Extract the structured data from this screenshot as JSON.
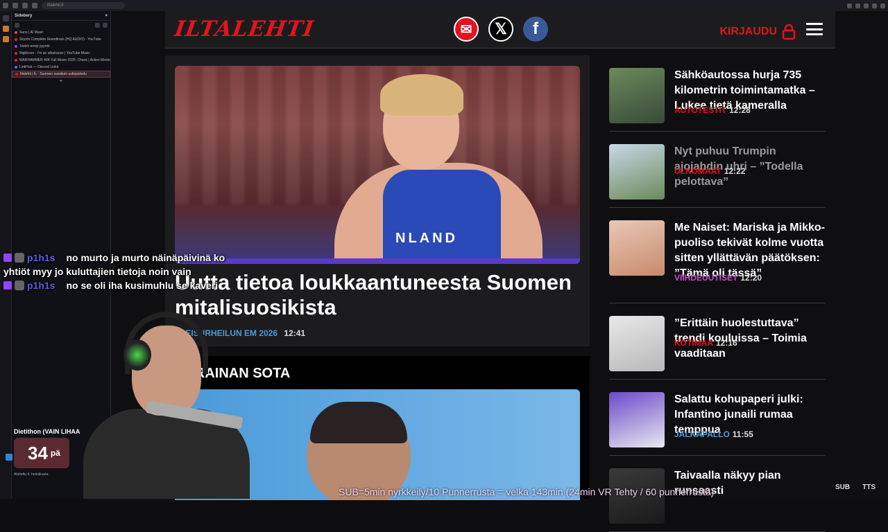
{
  "browser": {
    "url": "iltalehti.fi"
  },
  "sidebery": {
    "title": "Sidebery",
    "close": "×",
    "tabs": [
      {
        "label": "Suno | AI Music",
        "color": "#e84a4a"
      },
      {
        "label": "Skyrim Complete Soundtrack (HQ AUDIO) - YouTube",
        "color": "#e82222"
      },
      {
        "label": "Twitch emoji pyyntö",
        "color": "#9146ff"
      },
      {
        "label": "Nightcore - I'm an albatraozz | YouTube Music",
        "color": "#e82222"
      },
      {
        "label": "WARHAMMER 40K Full Movie 2025: Chaos | Action Movies",
        "color": "#e82222"
      },
      {
        "label": "LinkHub — Discord Linkit",
        "color": "#5a6ae8"
      },
      {
        "label": "Iltalehti | IL - Suomen suosituin uutispalvelu",
        "color": "#e3121f"
      }
    ],
    "add": "+"
  },
  "header": {
    "logo": "ILTALEHTI",
    "login": "KIRJAUDU",
    "x_glyph": "𝕏",
    "fb_glyph": "f",
    "mail_glyph": "✉"
  },
  "main_article": {
    "shirt_text": "NLAND",
    "title": "Uutta tietoa loukkaantuneesta Suomen mitalisuosikista",
    "category": "YLEISURHEILUN EM 2026",
    "time": "12:41"
  },
  "second_article": {
    "label": "UKRAINAN SOTA"
  },
  "side_articles": [
    {
      "title": "Sähköautossa hurja 735 kilometrin toimintamatka – Lukee tietä kameralla",
      "category": "AUTOTESTIT",
      "time": "12:28",
      "cat_color": "#e3121f",
      "dim": false
    },
    {
      "title": "Nyt puhuu Trumpin ajojahdin uhri – ”Todella pelottava”",
      "category": "ULKOMAAT",
      "time": "12:22",
      "cat_color": "#e3121f",
      "dim": true
    },
    {
      "title": "Me Naiset: Mariska ja Mikko-puoliso tekivät kolme vuotta sitten yllättävän päätöksen: ”Tämä oli tässä”",
      "category": "VIIHDEUUTISET",
      "time": "12:20",
      "cat_color": "#c84ad8",
      "dim": false
    },
    {
      "title": "”Erittäin huolestuttava” trendi kouluissa – Toimia vaaditaan",
      "category": "KOTIMAA",
      "time": "12:16",
      "cat_color": "#e3121f",
      "dim": false
    },
    {
      "title": "Salattu kohupaperi julki: Infantino junaili rumaa temppua",
      "category": "JALKAPALLO",
      "time": "11:55",
      "cat_color": "#4a9ad8",
      "dim": false
    },
    {
      "title": "Taivaalla näkyy pian runsaasti",
      "category": "",
      "time": "",
      "cat_color": "#e3121f",
      "dim": false
    }
  ],
  "chat": [
    {
      "user": "p1h1s",
      "text": "no murto ja murto näinäpäivinä ko"
    },
    {
      "user": "",
      "text": "yhtiöt myy jo kuluttajien tietoja noin vain"
    },
    {
      "user": "p1h1s",
      "text": "no se oli iha kusimuhlu se kaveri"
    }
  ],
  "event": {
    "title": "Dietithon (VAIN LIHAA",
    "count": "34",
    "unit": "pä",
    "sub": "Aloitettu 4. heinäkuuta"
  },
  "ticker": "SUB=5min nyrkkeily/10 Punnerrusta = velka 143min (24min VR Tehty / 60 punnerrusta)",
  "overlay_labels": {
    "sub": "SUB",
    "tts": "TTS"
  }
}
